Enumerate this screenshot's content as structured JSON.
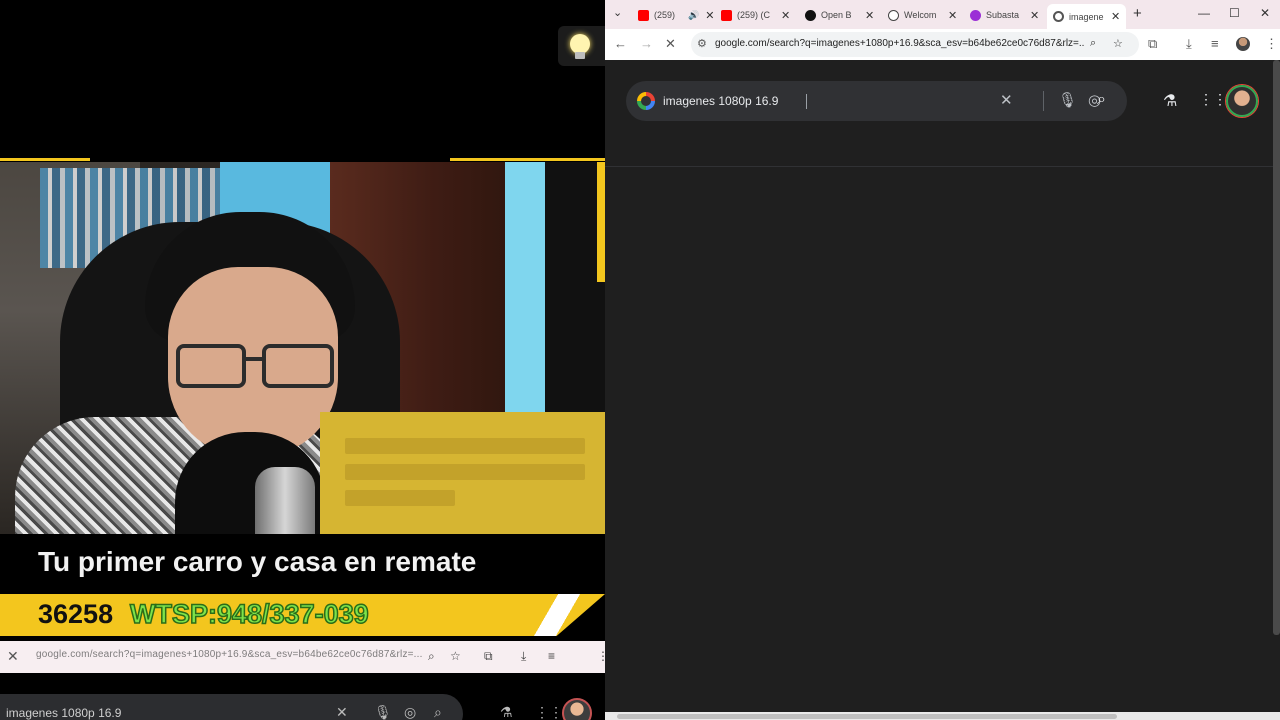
{
  "stream": {
    "caption": "Tu primer carro y casa en remate",
    "ticker_number": "36258",
    "ticker_whatsapp": "WTSP:948/337-039",
    "mini_url": "google.com/search?q=imagenes+1080p+16.9&sca_esv=b64be62ce0c76d87&rlz=...",
    "mini_query": "imagenes 1080p 16.9"
  },
  "tabs": [
    {
      "label": "(259)",
      "favicon": "youtube-icon",
      "color": "#ff0000",
      "sound": true
    },
    {
      "label": "(259) (C",
      "favicon": "youtube-icon",
      "color": "#ff0000",
      "sound": false
    },
    {
      "label": "Open B",
      "favicon": "openai-icon",
      "color": "#111111",
      "sound": false
    },
    {
      "label": "Welcom",
      "favicon": "globe-icon",
      "color": "#444444",
      "sound": false
    },
    {
      "label": "Subasta",
      "favicon": "purple-app-icon",
      "color": "#9b2fd6",
      "sound": false
    },
    {
      "label": "imagene",
      "favicon": "google-icon",
      "color": "#4285f4",
      "sound": false,
      "active": true
    }
  ],
  "toolbar": {
    "url": "google.com/search?q=imagenes+1080p+16.9&sca_esv=b64be62ce0c76d87&rlz=..."
  },
  "search": {
    "query": "imagenes 1080p 16.9"
  },
  "colors": {
    "accent_yellow": "#f3c61e",
    "ticker_green": "#7ee34a",
    "browser_bg": "#1f1f1f",
    "searchbox_bg": "#303134",
    "tabstrip_bg": "#f3e7ec"
  }
}
